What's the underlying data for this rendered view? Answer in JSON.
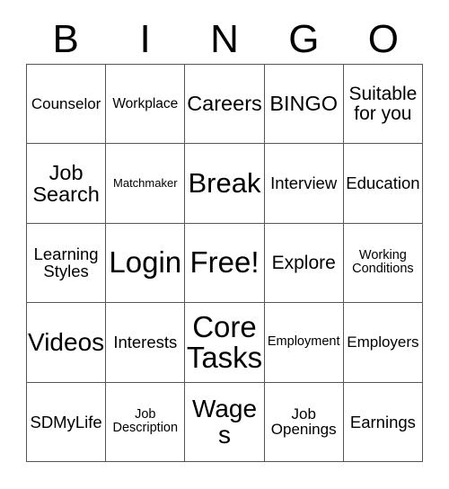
{
  "card": {
    "title": "BINGO",
    "header_letters": [
      "B",
      "I",
      "N",
      "G",
      "O"
    ],
    "columns": 5,
    "rows": 5,
    "border_color": "#555555",
    "text_color": "#000000",
    "background_color": "#ffffff",
    "free_space": "Free!"
  },
  "grid": {
    "rows": [
      {
        "cells": [
          {
            "label": "Counselor",
            "size": "md"
          },
          {
            "label": "Workplace",
            "size": "smd"
          },
          {
            "label": "Careers",
            "size": "xl"
          },
          {
            "label": "BINGO",
            "size": "xl"
          },
          {
            "label": "Suitable\nfor you",
            "size": "lg"
          }
        ]
      },
      {
        "cells": [
          {
            "label": "Job\nSearch",
            "size": "xl"
          },
          {
            "label": "Matchmaker",
            "size": "xs"
          },
          {
            "label": "Break",
            "size": "huge"
          },
          {
            "label": "Interview",
            "size": "mdl"
          },
          {
            "label": "Education",
            "size": "mdl"
          }
        ]
      },
      {
        "cells": [
          {
            "label": "Learning\nStyles",
            "size": "mdl"
          },
          {
            "label": "Login",
            "size": "mega"
          },
          {
            "label": "Free!",
            "size": "mega"
          },
          {
            "label": "Explore",
            "size": "lg"
          },
          {
            "label": "Working\nConditions",
            "size": "sm"
          }
        ]
      },
      {
        "cells": [
          {
            "label": "Videos",
            "size": "xxl"
          },
          {
            "label": "Interests",
            "size": "mdl"
          },
          {
            "label": "Core\nTasks",
            "size": "mega"
          },
          {
            "label": "Employment",
            "size": "sm"
          },
          {
            "label": "Employers",
            "size": "md"
          }
        ]
      },
      {
        "cells": [
          {
            "label": "SDMyLife",
            "size": "mdl"
          },
          {
            "label": "Job\nDescription",
            "size": "sm"
          },
          {
            "label": "Wages",
            "size": "xxl"
          },
          {
            "label": "Job\nOpenings",
            "size": "md"
          },
          {
            "label": "Earnings",
            "size": "mdl"
          }
        ]
      }
    ]
  }
}
